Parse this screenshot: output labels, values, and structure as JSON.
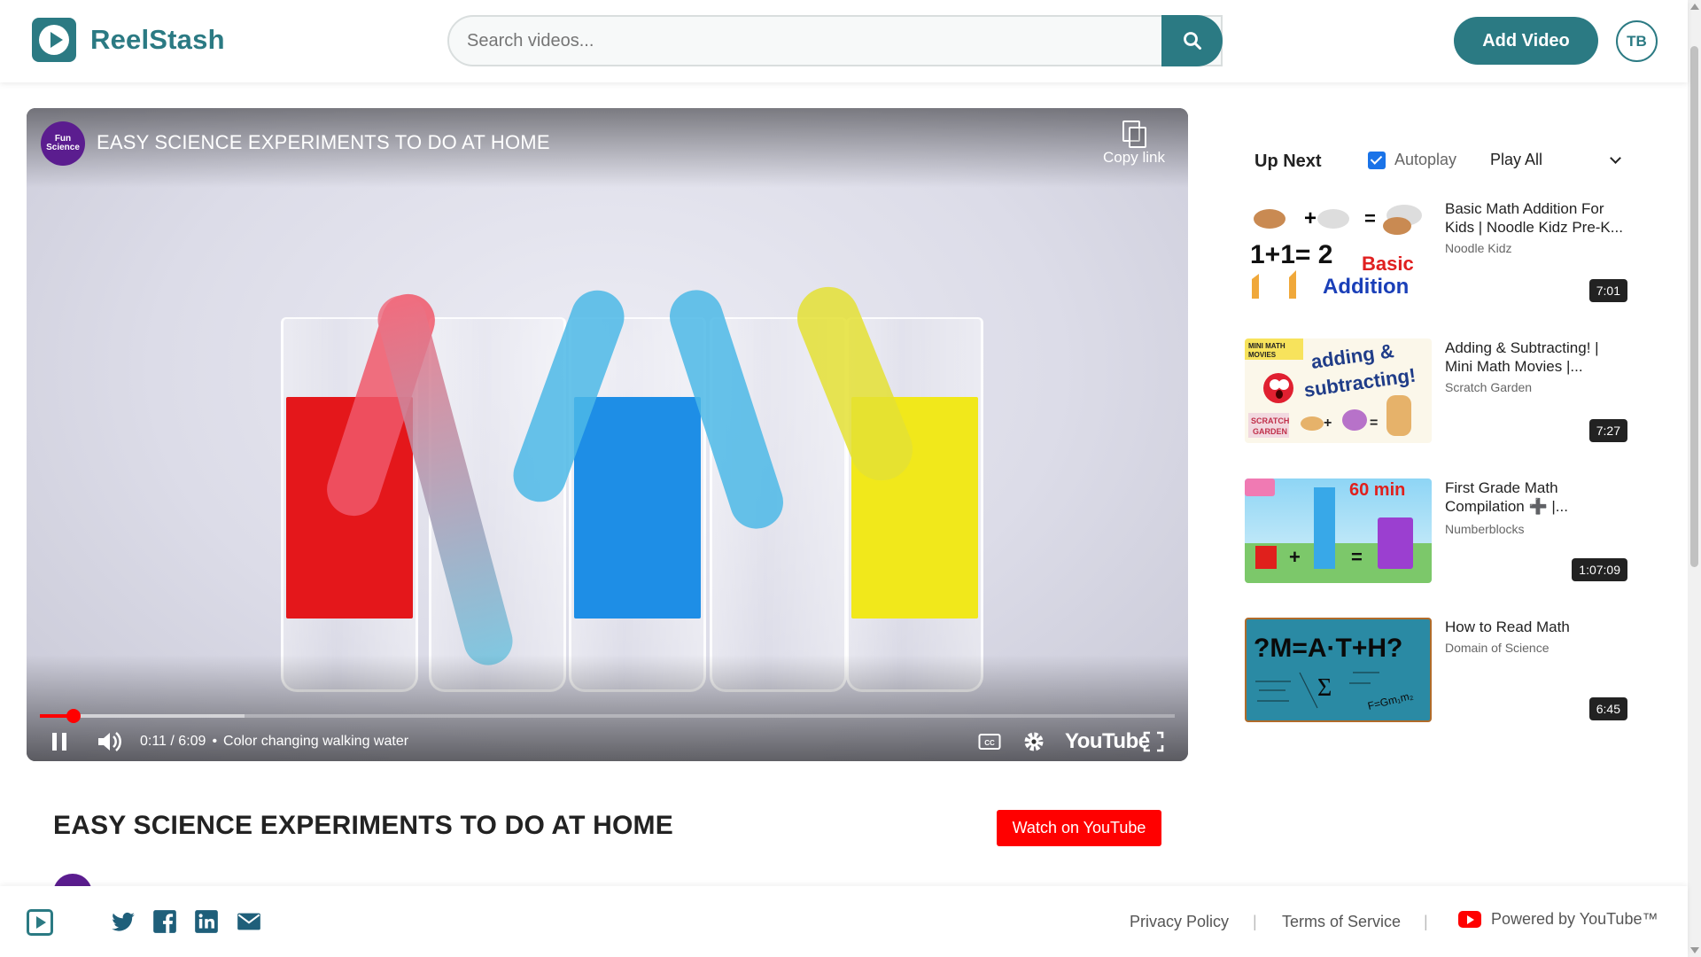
{
  "header": {
    "brand": "ReelStash",
    "search_placeholder": "Search videos...",
    "add_video_label": "Add Video",
    "avatar_initials": "TB",
    "accent_color": "#2b7a83"
  },
  "player": {
    "channel_logo_text": "Fun Science",
    "title": "EASY SCIENCE EXPERIMENTS TO DO AT HOME",
    "copy_link_label": "Copy link",
    "current_time": "0:11",
    "duration": "6:09",
    "chapter": "Color changing walking water",
    "time_display": "0:11 / 6:09",
    "chapter_separator": "•",
    "progress_fraction": 0.03,
    "buffer_fraction": 0.18,
    "youtube_label": "YouTube",
    "icons": [
      "pause-icon",
      "volume-icon",
      "captions-icon",
      "settings-icon",
      "fullscreen-icon"
    ]
  },
  "sidebar": {
    "title": "Up Next",
    "autoplay_label": "Autoplay",
    "autoplay_checked": true,
    "playall_label": "Play All",
    "items": [
      {
        "title": "Basic Math Addition For Kids | Noodle Kidz Pre-K...",
        "channel": "Noodle Kidz",
        "duration": "7:01",
        "thumb_text_1": "1+1= 2",
        "thumb_text_2": "Basic",
        "thumb_text_3": "Addition"
      },
      {
        "title": "Adding & Subtracting! | Mini Math Movies |...",
        "channel": "Scratch Garden",
        "duration": "7:27",
        "thumb_text_1": "adding &",
        "thumb_text_2": "subtracting!",
        "thumb_text_3": "MINI MATH MOVIES"
      },
      {
        "title": "First Grade Math Compilation ➕ |...",
        "channel": "Numberblocks",
        "duration": "1:07:09",
        "thumb_text_1": "60 min",
        "thumb_text_2": "+",
        "thumb_text_3": "="
      },
      {
        "title": "How to Read Math",
        "channel": "Domain of Science",
        "duration": "6:45",
        "thumb_text_1": "?M=A·T+H?",
        "thumb_text_2": "Σ",
        "thumb_text_3": "F=Gm₁m₂"
      }
    ]
  },
  "video_info": {
    "title": "EASY SCIENCE EXPERIMENTS TO DO AT HOME",
    "watch_label": "Watch on YouTube"
  },
  "footer": {
    "privacy": "Privacy Policy",
    "terms": "Terms of Service",
    "separator": "|",
    "powered": "Powered by YouTube™",
    "social_icons": [
      "twitter-icon",
      "facebook-icon",
      "linkedin-icon",
      "email-icon"
    ]
  }
}
